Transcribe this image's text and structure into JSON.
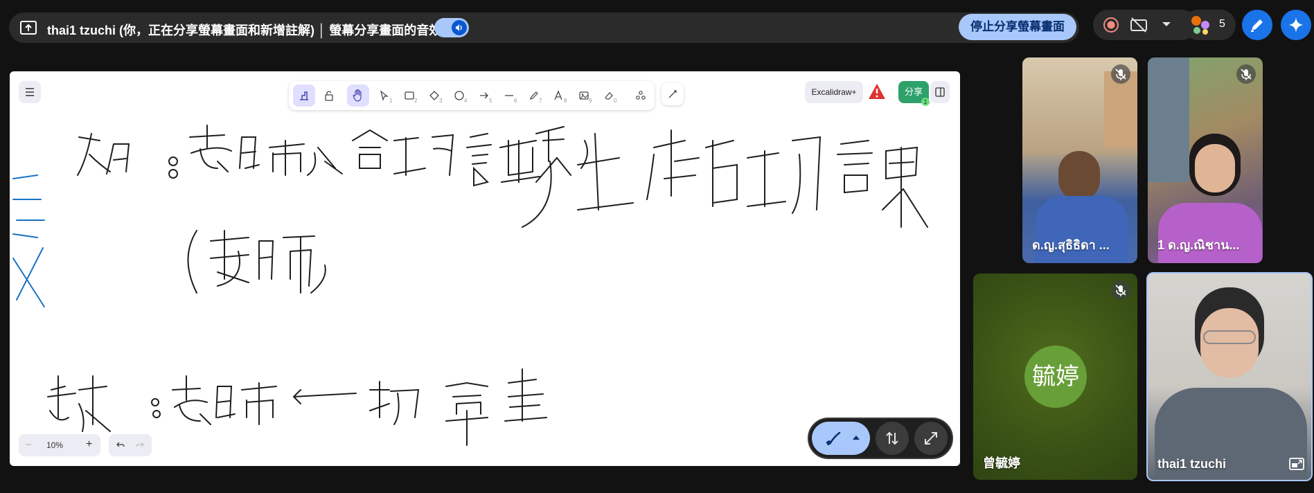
{
  "top_bar": {
    "share_status": "thai1 tzuchi (你，正在分享螢幕畫面和新增註解) │ 螢幕分享畫面的音效",
    "stop_share_label": "停止分享螢幕畫面",
    "participant_count": "5"
  },
  "whiteboard": {
    "excalidraw_label": "Excalidraw+",
    "share_label": "分享",
    "share_badge": "1",
    "zoom_level": "10%",
    "minus": "−",
    "plus": "+",
    "tool_numbers": [
      "1",
      "2",
      "3",
      "4",
      "5",
      "6",
      "7",
      "8",
      "9",
      "0"
    ],
    "handwriting_line1": "如:老師給功課學生在估功課",
    "handwriting_line2": "(老師)",
    "handwriting_line3": "支援:老師一打學生"
  },
  "participants": [
    {
      "name": "ด.ญ.สุธิธิดา ...",
      "muted": true
    },
    {
      "name": "1 ด.ญ.ณิชาน...",
      "muted": true
    },
    {
      "name": "曾毓婷",
      "avatar_text": "毓婷",
      "muted": true,
      "avatar_color": "#689f38"
    },
    {
      "name": "thai1 tzuchi",
      "muted": false
    }
  ],
  "colors": {
    "accent": "#a8c7fa",
    "brand_blue": "#0b57d0",
    "excalidraw_green": "#2ea16b",
    "warning_red": "#e03131"
  }
}
